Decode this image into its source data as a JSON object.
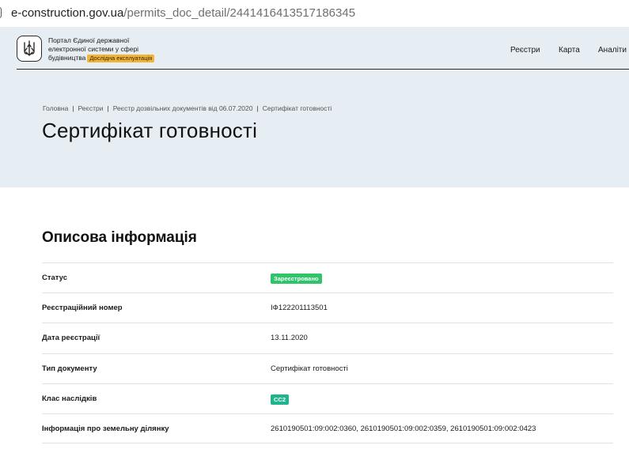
{
  "browser": {
    "url_host": "e-construction.gov.ua",
    "url_path": "/permits_doc_detail/2441416413517186345"
  },
  "header": {
    "portal_line1": "Портал Єдиної державної",
    "portal_line2": "електронної системи у сфері",
    "portal_line3": "будівництва",
    "trial_badge": "Дослідна експлуатація",
    "nav": [
      "Реєстри",
      "Карта",
      "Аналіти"
    ]
  },
  "breadcrumb": [
    "Головна",
    "Реєстри",
    "Реєстр дозвільних документів від 06.07.2020",
    "Сертифікат готовності"
  ],
  "page_title": "Сертифікат готовності",
  "section_title": "Описова інформація",
  "info_rows": [
    {
      "label": "Статус",
      "value": "Зареєстровано",
      "type": "pill",
      "color": "#2fc46a"
    },
    {
      "label": "Реєстраційний номер",
      "value": "ІФ122201113501",
      "type": "text"
    },
    {
      "label": "Дата реєстрації",
      "value": "13.11.2020",
      "type": "text"
    },
    {
      "label": "Тип документу",
      "value": "Сертифікат готовності",
      "type": "text"
    },
    {
      "label": "Клас наслідків",
      "value": "СС2",
      "type": "pill",
      "color": "#1fb48c"
    },
    {
      "label": "Інформація про земельну ділянку",
      "value": "2610190501:09:002:0360, 2610190501:09:002:0359, 2610190501:09:002:0423",
      "type": "text"
    }
  ],
  "colors": {
    "hero_bg": "#e6edf3",
    "badge_trial": "#f0b43a"
  }
}
